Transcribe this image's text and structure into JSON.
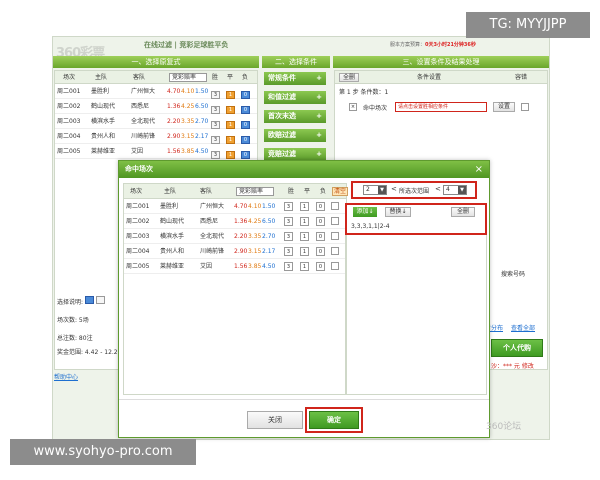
{
  "watermarks": {
    "top": "TG: MYYJJPP",
    "bottom": "www.syohyo-pro.com",
    "corner": "360论坛"
  },
  "header": {
    "logo": "360彩票",
    "subtitle": "在线过滤 | 竞彩足球胜平负",
    "note_prefix": "服本方案预算：",
    "note_highlight": "0天3小时21分钟36秒"
  },
  "steps": {
    "step1": "一、选择原复式",
    "step2": "二、选择条件",
    "step3": "三、设置条件及结果处理"
  },
  "left_table": {
    "headers": [
      "场次",
      "主队",
      "客队",
      "竞彩赔率",
      "胜",
      "平",
      "负"
    ],
    "rows": [
      {
        "id": "周二001",
        "home": "墨胜利",
        "away": "广州恒大",
        "o1": "4.70",
        "o2": "4.10",
        "o3": "1.50"
      },
      {
        "id": "周二002",
        "home": "鹤山现代",
        "away": "西悉尼",
        "o1": "1.36",
        "o2": "4.25",
        "o3": "6.50"
      },
      {
        "id": "周二003",
        "home": "横滨水手",
        "away": "全北现代",
        "o1": "2.20",
        "o2": "3.35",
        "o3": "2.70"
      },
      {
        "id": "周二004",
        "home": "贵州人和",
        "away": "川崎前锋",
        "o1": "2.90",
        "o2": "3.15",
        "o3": "2.17"
      },
      {
        "id": "周二005",
        "home": "莱赫维亚",
        "away": "艾因",
        "o1": "1.56",
        "o2": "3.85",
        "o3": "4.50"
      }
    ],
    "select_label": "选择说明:",
    "count_label": "场次数: 5场",
    "total_label": "总注数: 80注",
    "prize_label": "奖金范围: 4.42 - 12.2"
  },
  "help_link": "帮助中心",
  "conditions": {
    "buttons": [
      "常规条件",
      "和值过滤",
      "首次末选",
      "欧赔过滤",
      "竞赔过滤"
    ],
    "plus": "+"
  },
  "right_panel": {
    "select_all": "全删",
    "col_condition": "条件设置",
    "col_tolerance": "容错",
    "step_label": "第 1 步  条件数：1",
    "hit_label": "命中场次",
    "hit_placeholder": "请点击设置胜相应条件",
    "set_button": "设置",
    "ratio_label": "搜索号码",
    "link1": "看分布",
    "link2": "查看全部",
    "personal_button": "个人代购",
    "bottom_hint": "沙：*** 元 修改"
  },
  "modal": {
    "title": "命中场次",
    "close": "×",
    "headers": [
      "场次",
      "主队",
      "客队",
      "竞彩赔率",
      "胜",
      "平",
      "负",
      "清空"
    ],
    "rows": [
      {
        "id": "周二001",
        "home": "墨胜利",
        "away": "广州恒大",
        "o1": "4.70",
        "o2": "4.10",
        "o3": "1.50",
        "b1": "3",
        "b2": "1",
        "b3": "0"
      },
      {
        "id": "周二002",
        "home": "鹤山现代",
        "away": "西悉尼",
        "o1": "1.36",
        "o2": "4.25",
        "o3": "6.50",
        "b1": "3",
        "b2": "1",
        "b3": "0"
      },
      {
        "id": "周二003",
        "home": "横滨水手",
        "away": "全北现代",
        "o1": "2.20",
        "o2": "3.35",
        "o3": "2.70",
        "b1": "3",
        "b2": "1",
        "b3": "0"
      },
      {
        "id": "周二004",
        "home": "贵州人和",
        "away": "川崎前锋",
        "o1": "2.90",
        "o2": "3.15",
        "o3": "2.17",
        "b1": "3",
        "b2": "1",
        "b3": "0"
      },
      {
        "id": "周二005",
        "home": "莱赫维亚",
        "away": "艾因",
        "o1": "1.56",
        "o2": "3.85",
        "o3": "4.50",
        "b1": "3",
        "b2": "1",
        "b3": "0"
      }
    ],
    "range": {
      "min_value": "2",
      "lt1": "<",
      "label": "所选次范围",
      "lt2": "<",
      "max_value": "4"
    },
    "add_button": "添加",
    "replace_button": "替换",
    "delete_all_button": "全删",
    "condition_text": "3,3,3,1,1|2-4",
    "close_button": "关闭",
    "confirm_button": "确定"
  }
}
